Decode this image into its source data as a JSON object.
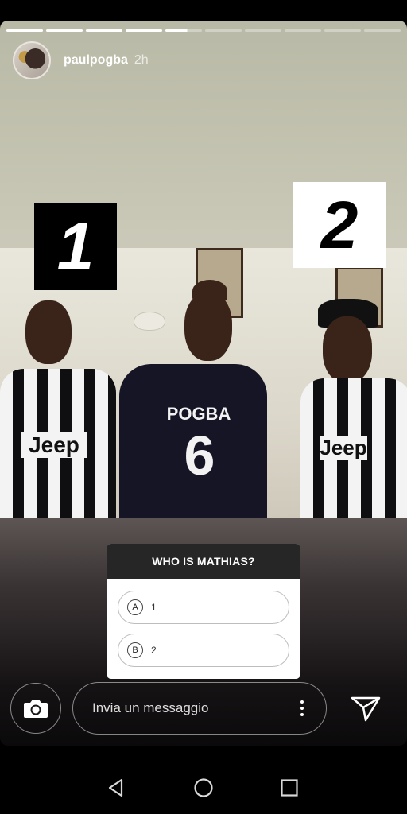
{
  "story": {
    "progress": {
      "total": 10,
      "completed": 4,
      "current_fraction": 0.6
    },
    "username": "paulpogba",
    "time": "2h",
    "image_labels": {
      "left": "1",
      "right": "2"
    },
    "jersey": {
      "name": "POGBA",
      "number": "6",
      "sponsor_left": "Jeep",
      "sponsor_right": "Jeep"
    }
  },
  "poll": {
    "question": "WHO IS MATHIAS?",
    "options": [
      {
        "letter": "A",
        "value": "1"
      },
      {
        "letter": "B",
        "value": "2"
      }
    ]
  },
  "reply": {
    "placeholder": "Invia un messaggio"
  },
  "icons": {
    "camera": "camera-icon",
    "more": "more-vertical-icon",
    "send": "direct-send-icon",
    "nav_back": "back-triangle-icon",
    "nav_home": "home-circle-icon",
    "nav_recents": "recents-square-icon"
  }
}
